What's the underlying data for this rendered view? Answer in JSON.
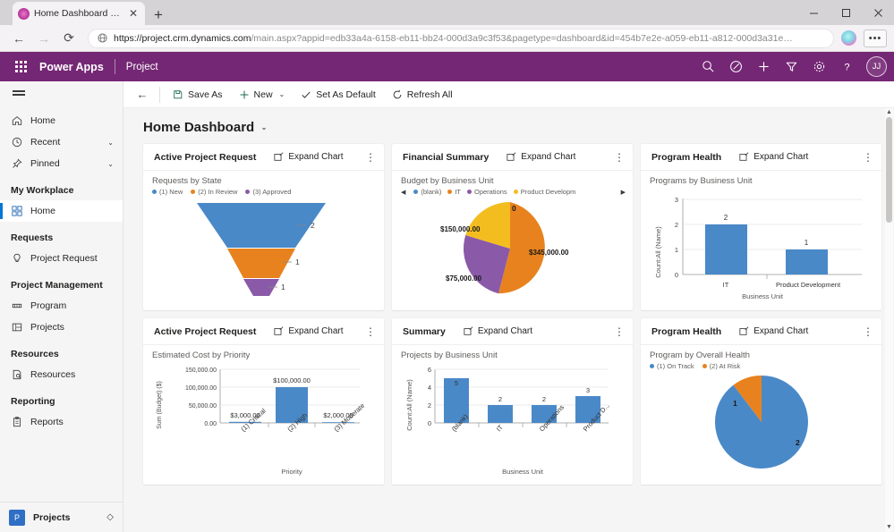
{
  "browser": {
    "tab": {
      "title": "Home Dashboard · Power Apps",
      "close_label": "✕",
      "favicon": "powerapps-icon"
    },
    "new_tab_label": "+",
    "window_controls": {
      "minimize": "minimize-icon",
      "maximize": "maximize-icon",
      "close": "close-icon"
    },
    "nav": {
      "back": "←",
      "forward": "→",
      "reload": "⟳"
    },
    "url_prefix": "https://project.crm.dynamics.com",
    "url_suffix": "/main.aspx?appid=edb33a4a-6158-eb11-bb24-000d3a9c3f53&pagetype=dashboard&id=454b7e2e-a059-eb11-a812-000d3a31e…",
    "more_label": "•••"
  },
  "appbar": {
    "waffle": "app-launcher-icon",
    "brand": "Power Apps",
    "app_name": "Project",
    "icons": [
      "search-icon",
      "pen-circle-icon",
      "plus-icon",
      "filter-icon",
      "gear-icon",
      "help-icon"
    ],
    "avatar_initials": "JJ"
  },
  "commandbar": {
    "back": "←",
    "save_as": "Save As",
    "new": "New",
    "set_as_default": "Set As Default",
    "refresh_all": "Refresh All",
    "chevron": "⌄"
  },
  "sidebar": {
    "hamburger": "menu-icon",
    "top_items": [
      {
        "label": "Home",
        "icon": "home-icon",
        "chevron": ""
      },
      {
        "label": "Recent",
        "icon": "clock-icon",
        "chevron": "⌄"
      },
      {
        "label": "Pinned",
        "icon": "pin-icon",
        "chevron": "⌄"
      }
    ],
    "groups": [
      {
        "title": "My Workplace",
        "items": [
          {
            "label": "Home",
            "icon": "dashboard-icon",
            "selected": true
          }
        ]
      },
      {
        "title": "Requests",
        "items": [
          {
            "label": "Project Request",
            "icon": "bulb-icon",
            "selected": false
          }
        ]
      },
      {
        "title": "Project Management",
        "items": [
          {
            "label": "Program",
            "icon": "program-icon",
            "selected": false
          },
          {
            "label": "Projects",
            "icon": "projects-icon",
            "selected": false
          }
        ]
      },
      {
        "title": "Resources",
        "items": [
          {
            "label": "Resources",
            "icon": "resource-icon",
            "selected": false
          }
        ]
      },
      {
        "title": "Reporting",
        "items": [
          {
            "label": "Reports",
            "icon": "report-icon",
            "selected": false
          }
        ]
      }
    ],
    "footer": {
      "badge": "P",
      "label": "Projects",
      "chevron": "◇"
    }
  },
  "page": {
    "title": "Home Dashboard",
    "title_chevron": "⌄",
    "expand_label": "Expand Chart",
    "kebab": "⋮"
  },
  "chart_data": [
    {
      "card_title": "Active Project Request",
      "type": "funnel",
      "title": "Requests by State",
      "categories": [
        "(1) New",
        "(2) In Review",
        "(3) Approved"
      ],
      "values": [
        2,
        1,
        1
      ],
      "colors": [
        "#4a89c8",
        "#e8821e",
        "#8a5aa8"
      ],
      "legend": "top"
    },
    {
      "card_title": "Financial Summary",
      "type": "pie",
      "title": "Budget by Business Unit",
      "categories": [
        "(blank)",
        "IT",
        "Operations",
        "Product Developm"
      ],
      "values": [
        0,
        345000,
        75000,
        150000
      ],
      "labels": [
        "0",
        "$345,000.00",
        "$75,000.00",
        "$150,000.00"
      ],
      "colors": [
        "#4a89c8",
        "#e8821e",
        "#8a5aa8",
        "#f4bd1f"
      ],
      "legend": "top",
      "legend_prev": "◀",
      "legend_next": "▶"
    },
    {
      "card_title": "Program Health",
      "type": "bar",
      "title": "Programs by Business Unit",
      "categories": [
        "IT",
        "Product Development"
      ],
      "values": [
        2,
        1
      ],
      "xlabel": "Business Unit",
      "ylabel": "Count:All (Name)",
      "yticks": [
        "0",
        "1",
        "2",
        "3"
      ],
      "ylim": [
        0,
        3
      ],
      "color": "#4a89c8"
    },
    {
      "card_title": "Active Project Request",
      "type": "bar",
      "title": "Estimated Cost by Priority",
      "categories": [
        "(1) Critical",
        "(2) High",
        "(3) Moderate"
      ],
      "values": [
        3000,
        100000,
        2000
      ],
      "labels": [
        "$3,000.00",
        "$100,000.00",
        "$2,000.00"
      ],
      "xlabel": "Priority",
      "ylabel": "Sum (Budget) ($)",
      "yticks": [
        "0.00",
        "50,000.00",
        "100,000.00",
        "150,000.00"
      ],
      "ylim": [
        0,
        150000
      ],
      "color": "#4a89c8"
    },
    {
      "card_title": "Summary",
      "type": "bar",
      "title": "Projects by Business Unit",
      "categories": [
        "(blank)",
        "IT",
        "Operations",
        "Product D..."
      ],
      "values": [
        5,
        2,
        2,
        3
      ],
      "xlabel": "Business Unit",
      "ylabel": "Count:All (Name)",
      "yticks": [
        "0",
        "2",
        "4",
        "6"
      ],
      "ylim": [
        0,
        6
      ],
      "color": "#4a89c8"
    },
    {
      "card_title": "Program Health",
      "type": "pie",
      "title": "Program by Overall Health",
      "categories": [
        "(1) On Track",
        "(2) At Risk"
      ],
      "values": [
        2,
        1
      ],
      "labels": [
        "2",
        "1"
      ],
      "colors": [
        "#4a89c8",
        "#e8821e"
      ],
      "legend": "top"
    }
  ]
}
